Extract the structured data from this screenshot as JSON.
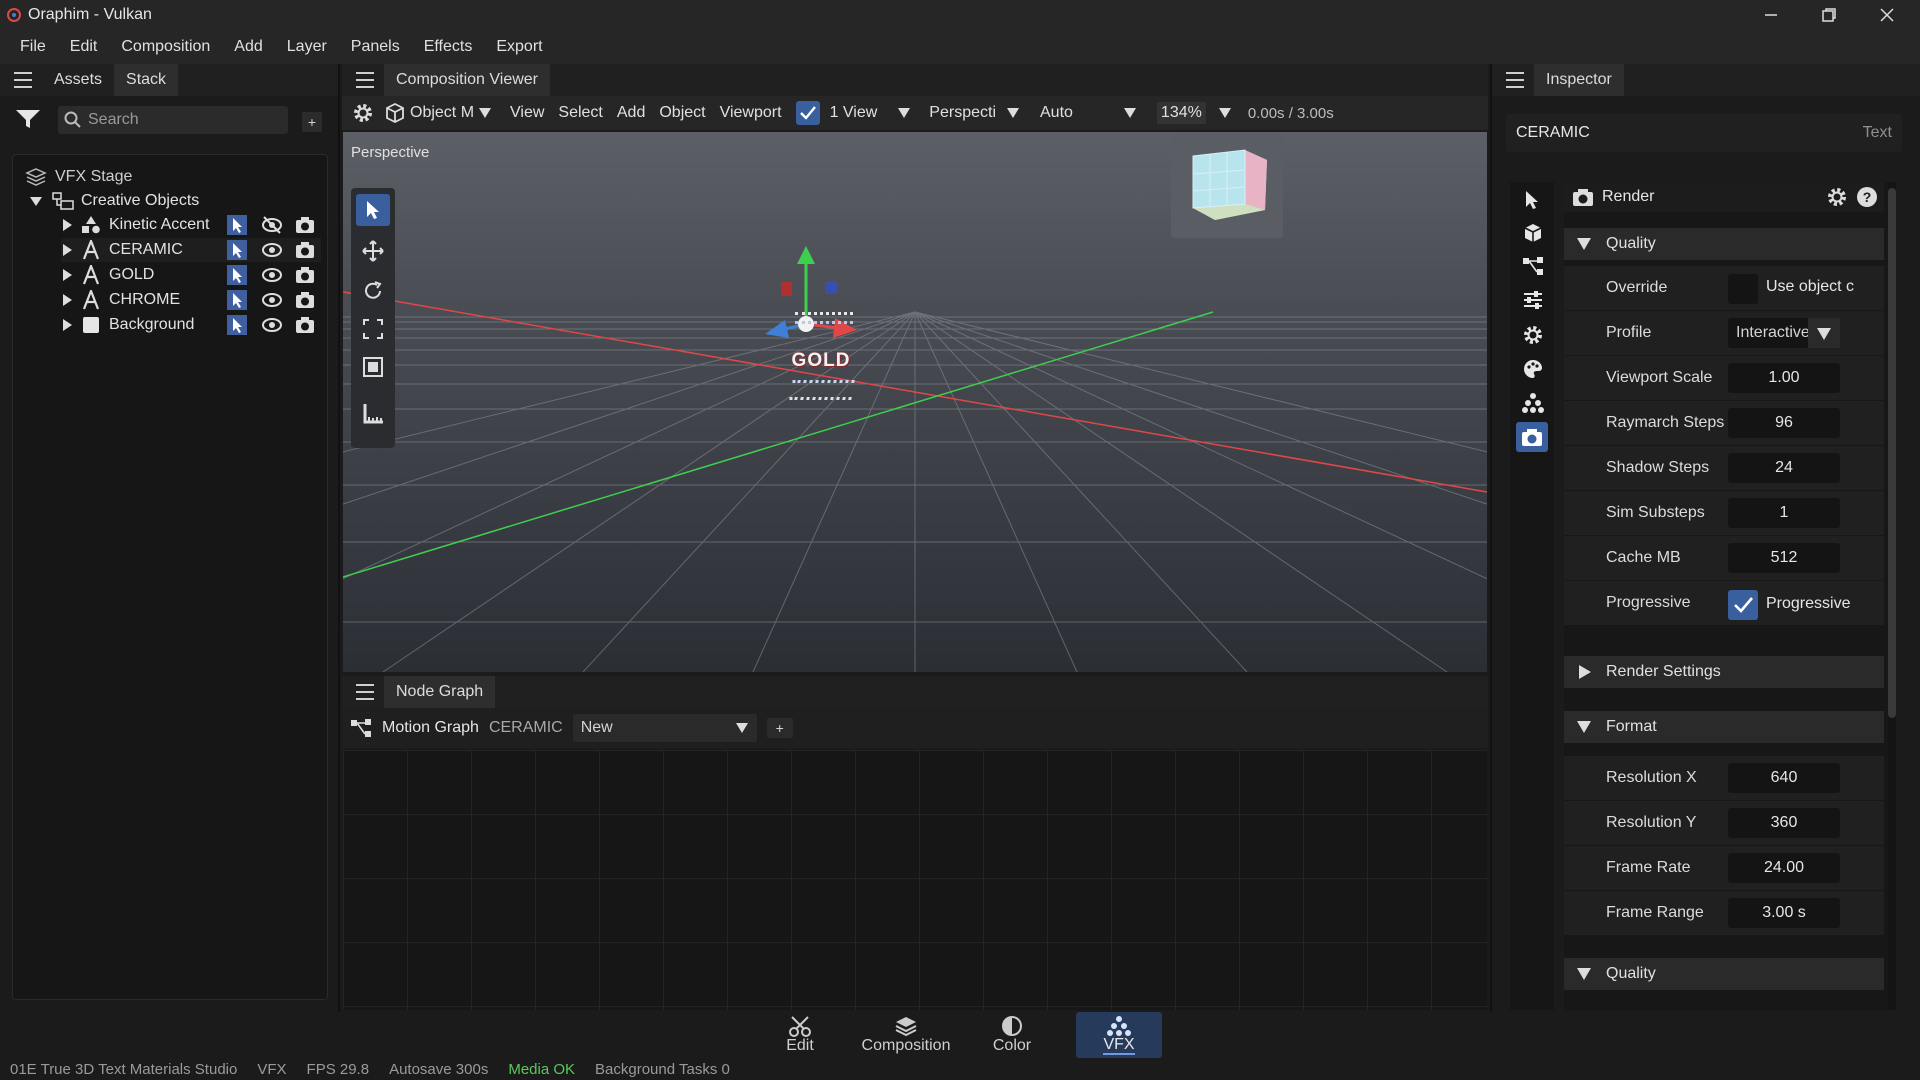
{
  "window": {
    "title": "Oraphim - Vulkan"
  },
  "menu": [
    "File",
    "Edit",
    "Composition",
    "Add",
    "Layer",
    "Panels",
    "Effects",
    "Export"
  ],
  "left_panel": {
    "tabs": [
      "Assets",
      "Stack"
    ],
    "search_placeholder": "Search",
    "add_label": "+",
    "tree": {
      "root": "VFX Stage",
      "group": "Creative Objects",
      "items": [
        {
          "label": "Kinetic Accent",
          "icon": "shapes-icon",
          "visible": false
        },
        {
          "label": "CERAMIC",
          "icon": "text-icon",
          "visible": true
        },
        {
          "label": "GOLD",
          "icon": "text-icon",
          "visible": true
        },
        {
          "label": "CHROME",
          "icon": "text-icon",
          "visible": true
        },
        {
          "label": "Background",
          "icon": "square-icon",
          "visible": true
        }
      ]
    }
  },
  "viewer": {
    "tab": "Composition Viewer",
    "toolbar": {
      "mode": "Object M",
      "menus": [
        "View",
        "Select",
        "Add",
        "Object",
        "Viewport"
      ],
      "view_count": "1 View",
      "projection": "Perspecti",
      "shading": "Auto",
      "zoom": "134%",
      "time": "0.00s / 3.00s"
    },
    "viewport_label": "Perspective",
    "scene_text": "GOLD"
  },
  "node_graph": {
    "tab": "Node Graph",
    "title": "Motion Graph",
    "target": "CERAMIC",
    "preset": "New",
    "add_label": "+"
  },
  "inspector": {
    "tab": "Inspector",
    "object_name": "CERAMIC",
    "object_type": "Text",
    "panel_title": "Render",
    "sections": {
      "quality": "Quality",
      "render_settings": "Render Settings",
      "format": "Format",
      "quality2": "Quality"
    },
    "quality_rows": {
      "override_label": "Override",
      "override_value": "Use object c",
      "profile_label": "Profile",
      "profile_value": "Interactive",
      "viewport_scale_label": "Viewport Scale",
      "viewport_scale_value": "1.00",
      "raymarch_label": "Raymarch Steps",
      "raymarch_value": "96",
      "shadow_label": "Shadow Steps",
      "shadow_value": "24",
      "sim_label": "Sim Substeps",
      "sim_value": "1",
      "cache_label": "Cache MB",
      "cache_value": "512",
      "progressive_label": "Progressive",
      "progressive_value": "Progressive"
    },
    "format_rows": {
      "resx_label": "Resolution X",
      "resx_value": "640",
      "resy_label": "Resolution Y",
      "resy_value": "360",
      "fps_label": "Frame Rate",
      "fps_value": "24.00",
      "range_label": "Frame Range",
      "range_value": "3.00 s"
    }
  },
  "modes": [
    {
      "label": "Edit",
      "icon": "scissors-icon"
    },
    {
      "label": "Composition",
      "icon": "layers-icon"
    },
    {
      "label": "Color",
      "icon": "color-icon"
    },
    {
      "label": "VFX",
      "icon": "vfx-icon",
      "active": true
    }
  ],
  "status": {
    "project": "01E True 3D Text Materials Studio",
    "mode": "VFX",
    "fps": "FPS 29.8",
    "autosave": "Autosave 300s",
    "media": "Media OK",
    "tasks": "Background Tasks 0"
  },
  "colors": {
    "accent": "#3f7fd8",
    "axis_x": "#e04848",
    "axis_y": "#3fcf4e",
    "media_ok": "#5ac85a"
  }
}
